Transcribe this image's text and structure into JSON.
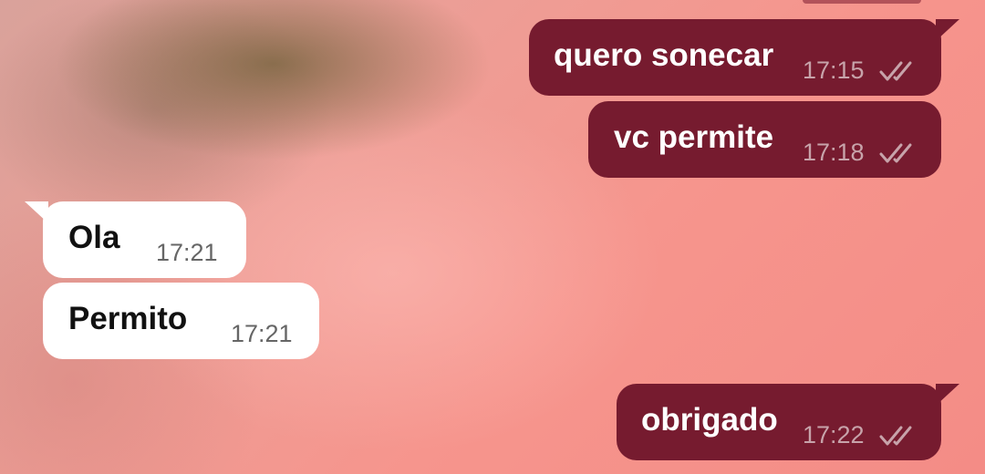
{
  "chat": {
    "messages": [
      {
        "direction": "out",
        "text": "quero sonecar",
        "time": "17:15",
        "status_icon": "double-check-icon"
      },
      {
        "direction": "out",
        "text": "vc permite",
        "time": "17:18",
        "status_icon": "double-check-icon"
      },
      {
        "direction": "in",
        "text": "Ola",
        "time": "17:21"
      },
      {
        "direction": "in",
        "text": "Permito",
        "time": "17:21"
      },
      {
        "direction": "out",
        "text": "obrigado",
        "time": "17:22",
        "status_icon": "double-check-icon"
      }
    ]
  },
  "colors": {
    "outgoing_bubble": "#761b2f",
    "incoming_bubble": "#ffffff",
    "wallpaper": "#f4958d"
  }
}
